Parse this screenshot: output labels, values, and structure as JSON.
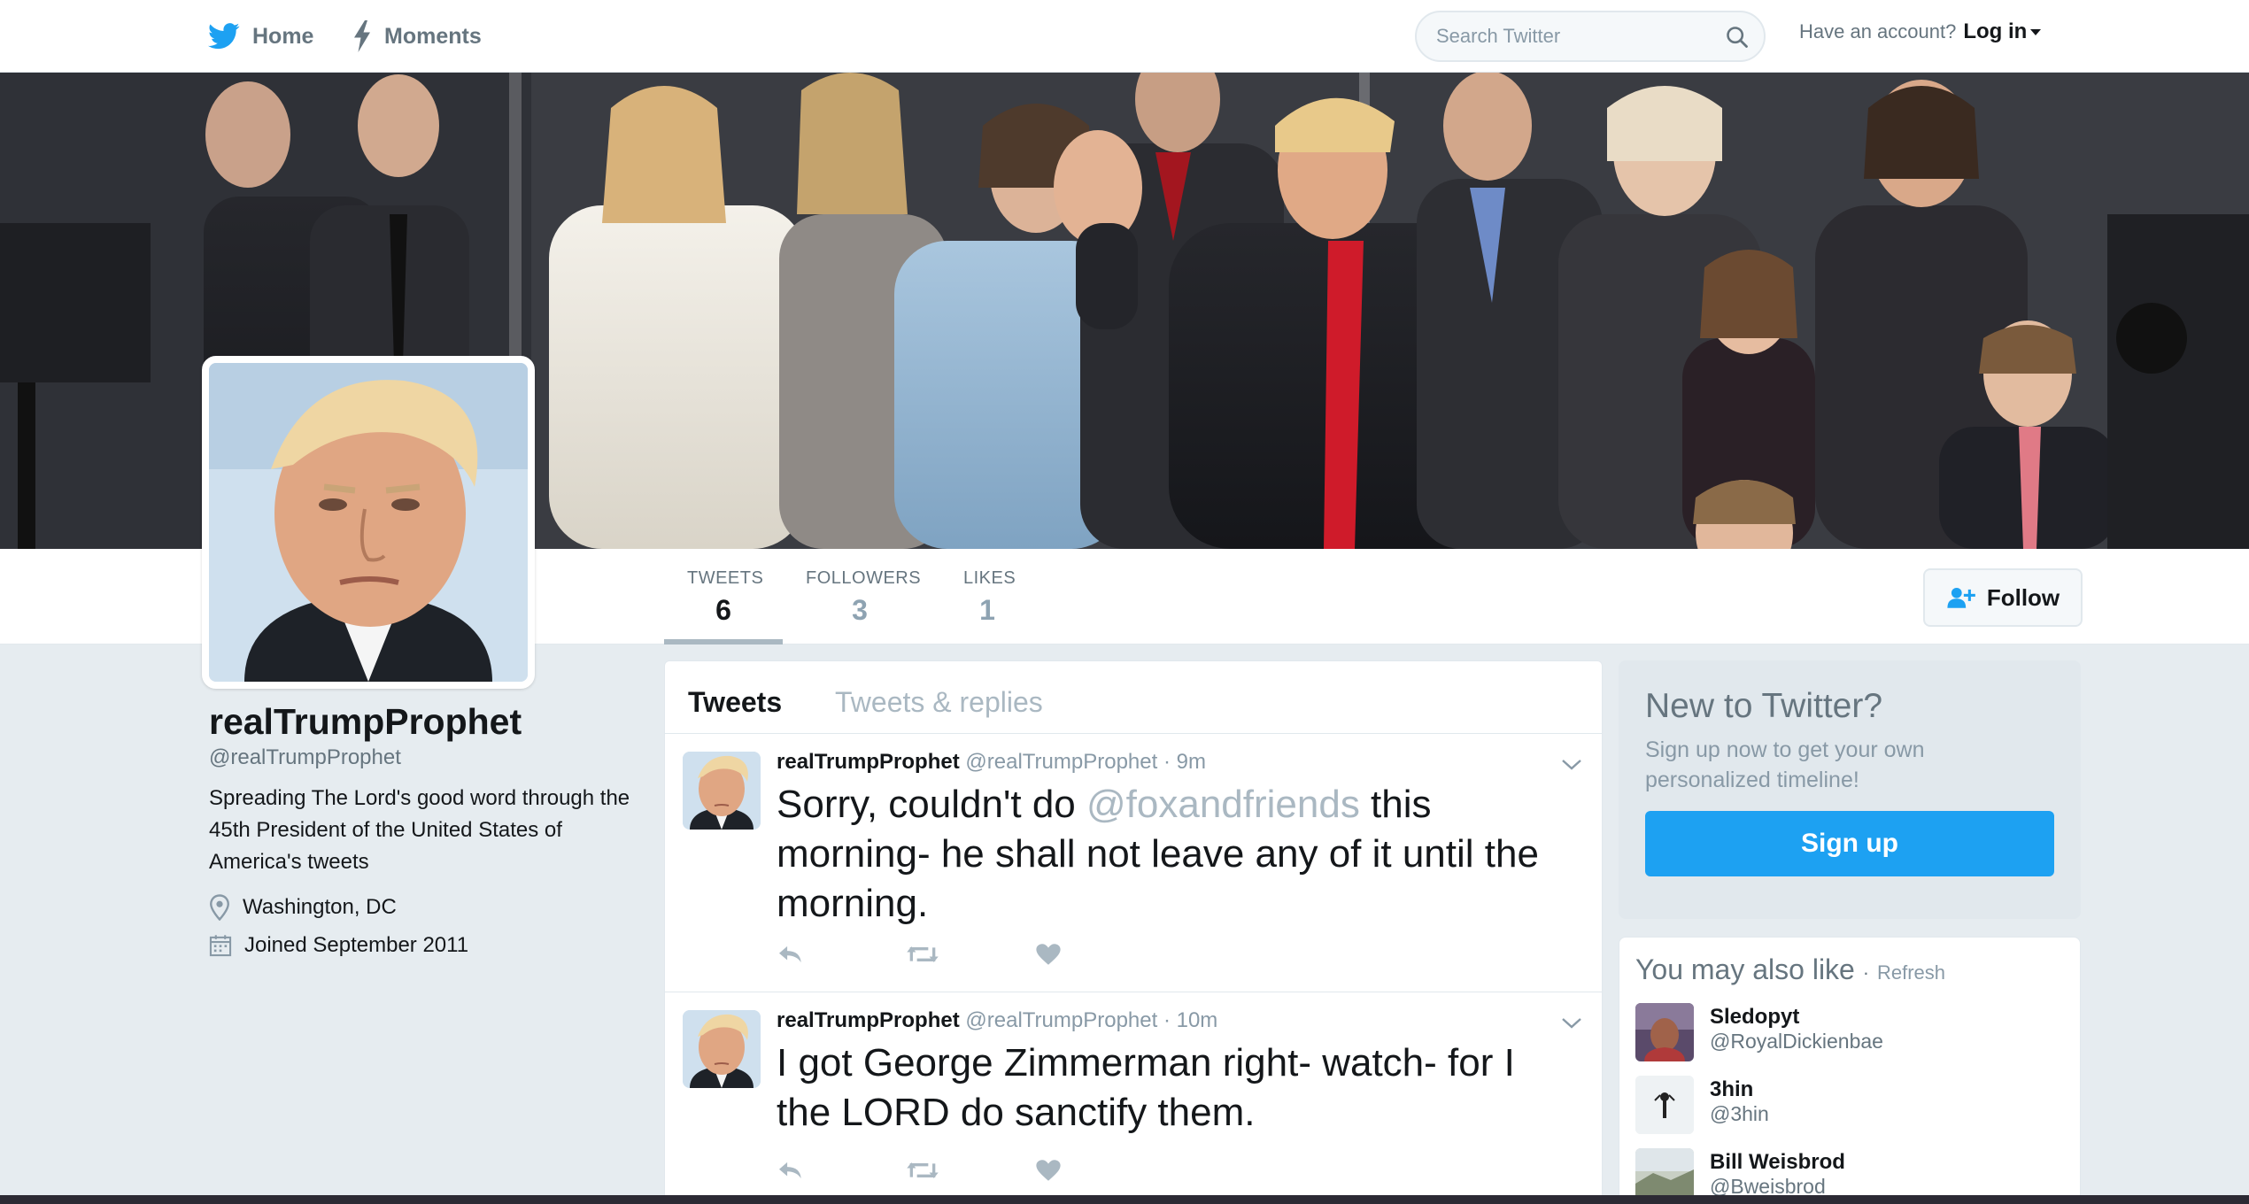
{
  "nav": {
    "home_label": "Home",
    "moments_label": "Moments",
    "search_placeholder": "Search Twitter",
    "account_prompt": "Have an account?",
    "login_label": "Log in"
  },
  "profile": {
    "name": "realTrumpProphet",
    "handle": "@realTrumpProphet",
    "bio": "Spreading The Lord's good word through the 45th President of the United States of America's tweets",
    "location": "Washington, DC",
    "joined": "Joined September 2011"
  },
  "stats": {
    "tweets_label": "TWEETS",
    "tweets_value": "6",
    "followers_label": "FOLLOWERS",
    "followers_value": "3",
    "likes_label": "LIKES",
    "likes_value": "1"
  },
  "follow_label": "Follow",
  "timeline": {
    "tab_tweets": "Tweets",
    "tab_replies": "Tweets & replies",
    "tweets": [
      {
        "name": "realTrumpProphet",
        "handle": "@realTrumpProphet",
        "time": "· 9m",
        "text_before": "Sorry, couldn't do ",
        "mention": "@foxandfriends",
        "text_after": " this morning- he shall not leave any of it until the morning."
      },
      {
        "name": "realTrumpProphet",
        "handle": "@realTrumpProphet",
        "time": "· 10m",
        "text": "I got George Zimmerman right- watch-  for I the LORD do sanctify them."
      }
    ]
  },
  "signup": {
    "title": "New to Twitter?",
    "subtitle": "Sign up now to get your own personalized timeline!",
    "button": "Sign up"
  },
  "suggestions": {
    "title": "You may also like",
    "dot": "·",
    "refresh": "Refresh",
    "users": [
      {
        "name": "Sledopyt",
        "handle": "@RoyalDickienbae"
      },
      {
        "name": "3hin",
        "handle": "@3hin"
      },
      {
        "name": "Bill Weisbrod",
        "handle": "@Bweisbrod"
      }
    ]
  },
  "colors": {
    "brand": "#1da1f2",
    "text": "#14171a",
    "muted": "#66757f",
    "background": "#e6ecf0"
  }
}
